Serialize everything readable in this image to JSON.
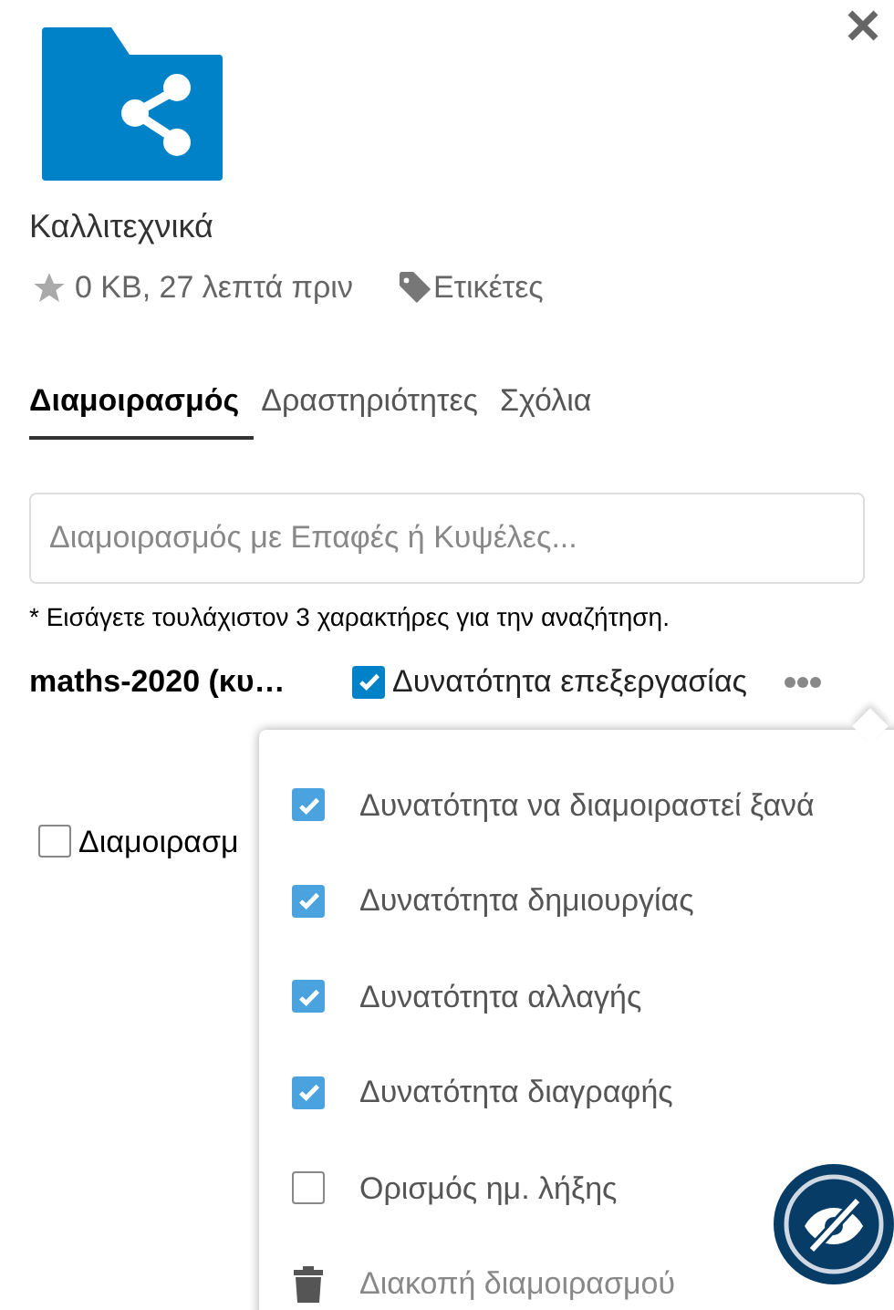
{
  "header": {
    "name": "Καλλιτεχνικά",
    "meta": "0 KB, 27 λεπτά πριν",
    "tags_label": "Ετικέτες"
  },
  "tabs": [
    {
      "label": "Διαμοιρασμός",
      "selected": true
    },
    {
      "label": "Δραστηριότητες",
      "selected": false
    },
    {
      "label": "Σχόλια",
      "selected": false
    }
  ],
  "search": {
    "placeholder": "Διαμοιρασμός με Επαφές ή Κυψέλες..."
  },
  "hint": "* Εισάγετε τουλάχιστον 3 χαρακτήρες για την αναζήτηση.",
  "share": {
    "name": "maths-2020 (κυ…",
    "can_edit": true,
    "edit_label": "Δυνατότητα επεξεργασίας"
  },
  "share_link": {
    "label": "Διαμοιρασμ",
    "checked": false
  },
  "menu": {
    "items": [
      {
        "kind": "checkbox",
        "label": "Δυνατότητα να διαμοιραστεί ξανά",
        "checked": true
      },
      {
        "kind": "checkbox",
        "label": "Δυνατότητα δημιουργίας",
        "checked": true
      },
      {
        "kind": "checkbox",
        "label": "Δυνατότητα αλλαγής",
        "checked": true
      },
      {
        "kind": "checkbox",
        "label": "Δυνατότητα διαγραφής",
        "checked": true
      },
      {
        "kind": "checkbox",
        "label": "Ορισμός ημ. λήξης",
        "checked": false
      },
      {
        "kind": "action",
        "label": "Διακοπή διαμοιρασμού"
      }
    ]
  }
}
